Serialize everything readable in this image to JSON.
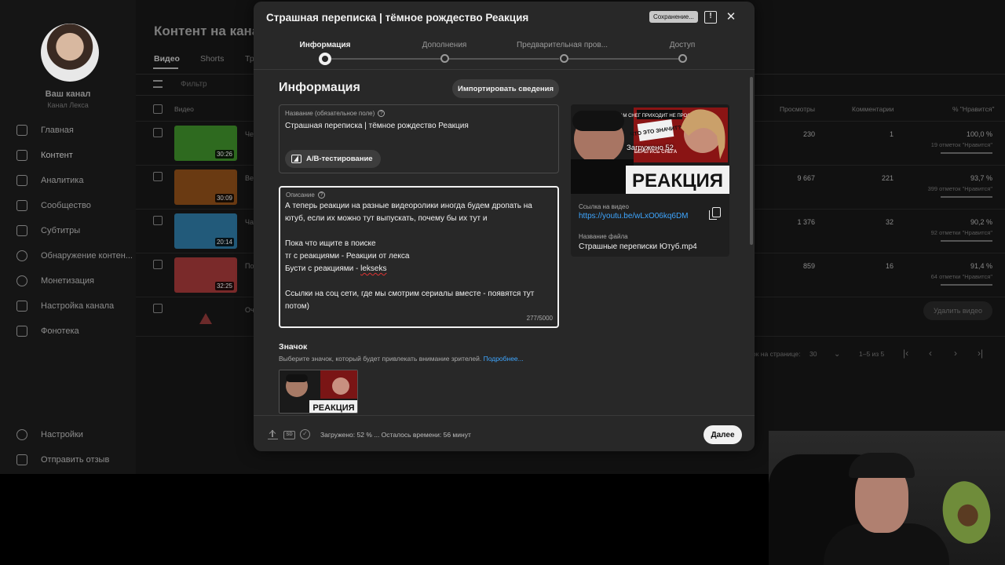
{
  "studio": {
    "channel": {
      "name": "Ваш канал",
      "sub": "Канал Лекса"
    },
    "nav": [
      {
        "label": "Главная",
        "icon": "dashboard-icon"
      },
      {
        "label": "Контент",
        "icon": "content-icon"
      },
      {
        "label": "Аналитика",
        "icon": "analytics-icon"
      },
      {
        "label": "Сообщество",
        "icon": "community-icon"
      },
      {
        "label": "Субтитры",
        "icon": "subtitles-icon"
      },
      {
        "label": "Обнаружение контен...",
        "icon": "copyright-icon"
      },
      {
        "label": "Монетизация",
        "icon": "monetization-icon"
      },
      {
        "label": "Настройка канала",
        "icon": "customization-icon"
      },
      {
        "label": "Фонотека",
        "icon": "audio-library-icon"
      }
    ],
    "nav_bottom": [
      {
        "label": "Настройки",
        "icon": "settings-icon"
      },
      {
        "label": "Отправить отзыв",
        "icon": "feedback-icon"
      }
    ],
    "page_title": "Контент на канал",
    "tabs": [
      "Видео",
      "Shorts",
      "Тр"
    ],
    "filter_placeholder": "Фильтр",
    "columns": {
      "video": "Видео",
      "views": "Просмотры",
      "comments": "Комментарии",
      "likes": "% \"Нравится\""
    },
    "rows": [
      {
        "title_stub": "Че",
        "duration": "30:26",
        "views": "230",
        "comments": "1",
        "likes_pct": "100,0 %",
        "likes_sub": "19 отметок \"Нравится\"",
        "thumb_color": "#2e6a1f"
      },
      {
        "title_stub": "Ве",
        "duration": "30:09",
        "views": "9 667",
        "comments": "221",
        "likes_pct": "93,7 %",
        "likes_sub": "399 отметок \"Нравится\"",
        "thumb_color": "#6a3a12"
      },
      {
        "title_stub": "Ча",
        "duration": "20:14",
        "views": "1 376",
        "comments": "32",
        "likes_pct": "90,2 %",
        "likes_sub": "92 отметки \"Нравится\"",
        "thumb_color": "#225a7a"
      },
      {
        "title_stub": "По",
        "duration": "32:25",
        "views": "859",
        "comments": "16",
        "likes_pct": "91,4 %",
        "likes_sub": "64 отметки \"Нравится\"",
        "thumb_color": "#7a2a2a"
      }
    ],
    "row5_stub": "Оч",
    "delete_label": "Удалить видео",
    "pager": {
      "per_page_label": "ок на странице:",
      "per_page": "30",
      "range": "1–5 из 5"
    }
  },
  "modal": {
    "title": "Страшная переписка | тёмное рождество Реакция",
    "saving": "Сохранение...",
    "steps": [
      "Информация",
      "Дополнения",
      "Предварительная пров...",
      "Доступ"
    ],
    "section_title": "Информация",
    "import_label": "Импортировать сведения",
    "title_field": {
      "label": "Название (обязательное поле)",
      "value": "Страшная переписка | тёмное рождество Реакция"
    },
    "ab_label": "A/B-тестирование",
    "description": {
      "label": "Описание",
      "line1": "А теперь реакции на разные видеоролики иногда будем дропать на ютуб, если их можно тут выпускать, почему бы их тут и",
      "line2": "Пока что ищите в поиске",
      "line3": "тг с реакциями - Реакции от лекса",
      "line4_prefix": "Бусти с реакциями - ",
      "line4_link": "lekseks",
      "line5": "Ссылки на соц сети, где мы смотрим сериалы вместе - появятся тут потом)",
      "count": "277/5000"
    },
    "thumbnail": {
      "heading": "Значок",
      "sub": "Выберите значок, который будет привлекать внимание зрителей.",
      "more": "Подробнее..."
    },
    "preview": {
      "uploading": "Загружено 52",
      "link_label": "Ссылка на видео",
      "link": "https://youtu.be/wLxO06kq6DM",
      "file_label": "Название файла",
      "file": "Страшные переписки Ютуб.mp4",
      "thumb_text": "РЕАКЦИЯ",
      "thumb_top": "К НАМ СНЕГ ПРИХОДИТ НЕ ПРОСТО ТАК",
      "thumb_mid": "ЧТО ЭТО ЗНАЧИТ?",
      "thumb_warn": "БЕРЕГИСЬ СНЕГА"
    },
    "footer": {
      "sd": "SD",
      "status": "Загружено: 52 % ... Осталось времени: 56 минут",
      "next": "Далее"
    }
  }
}
